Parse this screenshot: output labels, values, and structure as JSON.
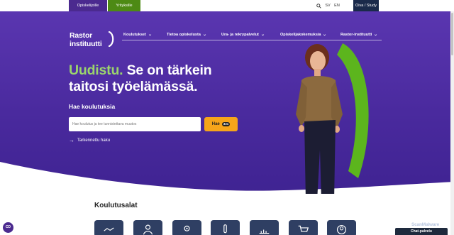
{
  "top_bar": {
    "audience_tabs": [
      "Opiskelijoille",
      "Yrityksille"
    ],
    "language_links": [
      "SV",
      "EN"
    ],
    "search_icon": "search-icon",
    "portal_button": "Oiva / Study"
  },
  "logo": {
    "line1": "Rastor",
    "line2": "instituutti"
  },
  "nav": {
    "items": [
      "Koulutukset",
      "Tietoa opiskelusta",
      "Ura- ja rekrypalvelut",
      "Opiskelijakokemuksia",
      "Rastor-instituutti"
    ]
  },
  "hero": {
    "headline_accent": "Uudistu.",
    "headline_rest": " Se on tärkein taitosi työelämässä.",
    "search_label": "Hae koulutuksia",
    "search_placeholder": "Hae koulutus ja tee tunnistettava muutos",
    "search_button": "Hae",
    "search_count": "331",
    "advanced_search": "Tarkennettu haku"
  },
  "fields": {
    "title": "Koulutusalat",
    "icons": [
      "handshake-icon",
      "person-icon",
      "gear-head-icon",
      "thermometer-icon",
      "chart-icon",
      "cart-icon",
      "user-circle-icon"
    ]
  },
  "floating": {
    "accessibility_badge": "CD",
    "watermark": "ScanMalware",
    "chat": "Chat-palvelu"
  },
  "colors": {
    "purple": "#4b2a8f",
    "green": "#4d8a14",
    "accent_green_text": "#9bd56c",
    "orange_button": "#f6a51a",
    "navy": "#1a2a4a",
    "tile": "#2f3f63"
  }
}
